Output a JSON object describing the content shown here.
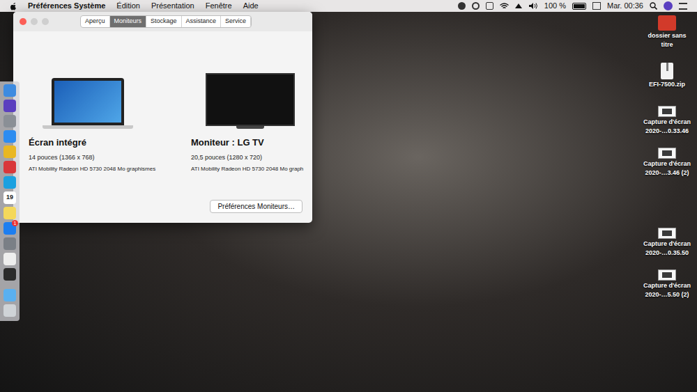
{
  "menu_bar": {
    "app": "Préférences Système",
    "menus": [
      "Édition",
      "Présentation",
      "Fenêtre",
      "Aide"
    ],
    "battery": {
      "reading": "100 %",
      "level": 1
    },
    "clock": "Mar. 00:36"
  },
  "window": {
    "tabs": [
      {
        "label": "Aperçu",
        "selected": false
      },
      {
        "label": "Moniteurs",
        "selected": true
      },
      {
        "label": "Stockage",
        "selected": false
      },
      {
        "label": "Assistance",
        "selected": false
      },
      {
        "label": "Service",
        "selected": false
      }
    ],
    "displays": [
      {
        "kind": "laptop",
        "name": "Écran intégré",
        "size": "14 pouces (1366 x 768)",
        "graphics": "ATI Mobility Radeon HD 5730 2048 Mo graphismes"
      },
      {
        "kind": "tv",
        "name": "Moniteur : LG TV",
        "size": "20,5 pouces (1280 x 720)",
        "graphics": "ATI Mobility Radeon HD 5730 2048 Mo graph"
      }
    ],
    "button": "Préférences Moniteurs…"
  },
  "dock": {
    "items": [
      {
        "kind": "finder",
        "text": "",
        "badge": ""
      },
      {
        "kind": "siri",
        "text": "",
        "badge": ""
      },
      {
        "kind": "launchpad",
        "text": "",
        "badge": ""
      },
      {
        "kind": "safari",
        "text": "",
        "badge": ""
      },
      {
        "kind": "chrome",
        "text": "",
        "badge": ""
      },
      {
        "kind": "vivaldi",
        "text": "",
        "badge": ""
      },
      {
        "kind": "skype",
        "text": "",
        "badge": ""
      },
      {
        "kind": "calendar",
        "text": "19",
        "badge": ""
      },
      {
        "kind": "notes",
        "text": "",
        "badge": ""
      },
      {
        "kind": "appstore",
        "text": "",
        "badge": "1"
      },
      {
        "kind": "prefs",
        "text": "",
        "badge": ""
      },
      {
        "kind": "textedit",
        "text": "",
        "badge": ""
      },
      {
        "kind": "activity",
        "text": "",
        "badge": ""
      },
      {
        "kind": "downloads",
        "text": "",
        "badge": ""
      },
      {
        "kind": "trash",
        "text": "",
        "badge": ""
      }
    ]
  },
  "desktop": {
    "items": [
      {
        "kind": "folder",
        "lines": [
          "dossier sans",
          "titre"
        ]
      },
      {
        "kind": "zip",
        "lines": [
          "EFI-7500.zip"
        ]
      },
      {
        "kind": "capture",
        "lines": [
          "Capture d'écran",
          "2020-…0.33.46"
        ]
      },
      {
        "kind": "capture",
        "lines": [
          "Capture d'écran",
          "2020-…3.46 (2)"
        ]
      },
      {
        "kind": "capture",
        "lines": [
          "Capture d'écran",
          "2020-…0.35.50"
        ]
      },
      {
        "kind": "capture",
        "lines": [
          "Capture d'écran",
          "2020-…5.50 (2)"
        ]
      }
    ]
  }
}
